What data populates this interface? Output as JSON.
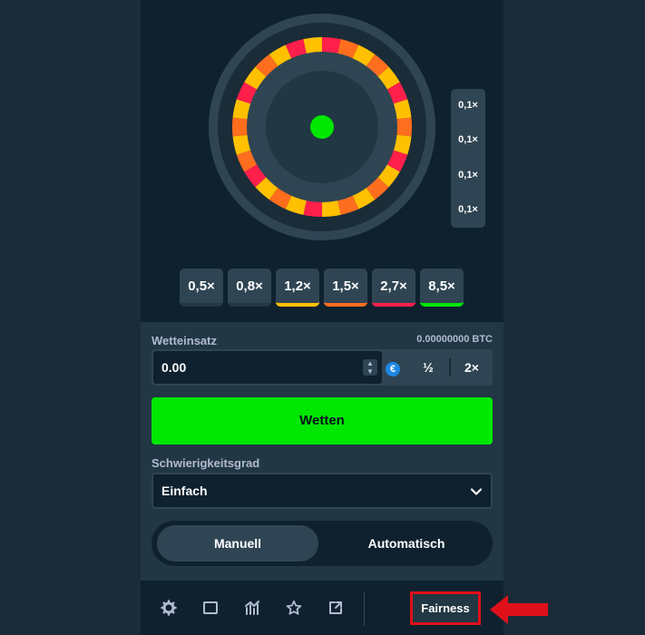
{
  "history": [
    "0,1×",
    "0,1×",
    "0,1×",
    "0,1×"
  ],
  "multipliers": [
    {
      "label": "0,5×",
      "color": ""
    },
    {
      "label": "0,8×",
      "color": ""
    },
    {
      "label": "1,2×",
      "color": "#ffc000"
    },
    {
      "label": "1,5×",
      "color": "#ff6d1f"
    },
    {
      "label": "2,7×",
      "color": "#ff1f4b"
    },
    {
      "label": "8,5×",
      "color": "#00e701"
    }
  ],
  "wheel": {
    "segments": [
      "red",
      "orange",
      "yellow",
      "orange",
      "yellow",
      "red",
      "yellow",
      "orange",
      "yellow",
      "red",
      "yellow",
      "orange",
      "yellow",
      "orange",
      "yellow",
      "red",
      "yellow",
      "orange",
      "yellow",
      "red",
      "orange",
      "yellow",
      "orange",
      "yellow",
      "red",
      "yellow",
      "orange",
      "yellow",
      "red",
      "yellow"
    ],
    "colors": {
      "red": "#ff1f4b",
      "orange": "#ff6d1f",
      "yellow": "#ffc000"
    },
    "center_color": "#00e701"
  },
  "bet": {
    "label": "Wetteinsatz",
    "btc_amount": "0.00000000 BTC",
    "value": "0.00",
    "currency_symbol": "€",
    "half_label": "½",
    "double_label": "2×"
  },
  "bet_button": "Wetten",
  "difficulty": {
    "label": "Schwierigkeitsgrad",
    "value": "Einfach"
  },
  "mode": {
    "manual": "Manuell",
    "auto": "Automatisch",
    "active": "manual"
  },
  "footer": {
    "icons": [
      "gear-icon",
      "window-icon",
      "chart-icon",
      "star-icon",
      "external-link-icon"
    ],
    "fairness_label": "Fairness"
  },
  "accent_colors": {
    "green": "#00e701",
    "highlight_red": "#e0101a"
  }
}
